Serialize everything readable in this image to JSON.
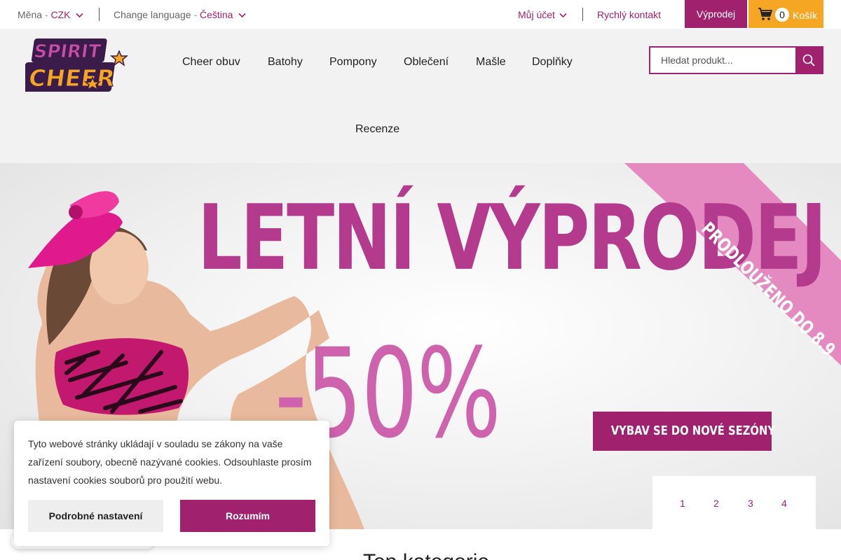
{
  "topbar": {
    "currency_label": "Měna",
    "currency_value": "CZK",
    "language_label": "Change language",
    "language_value": "Čeština",
    "separator": "-",
    "account": "Můj účet",
    "quick_contact": "Rychlý kontakt",
    "sale": "Výprodej",
    "cart_count": "0",
    "cart_label": "Košík"
  },
  "header": {
    "logo_line1": "SPIRIT",
    "logo_line2": "CHEER",
    "nav": [
      "Cheer obuv",
      "Batohy",
      "Pompony",
      "Oblečení",
      "Mašle",
      "Doplňky",
      "Recenze"
    ],
    "search_placeholder": "Hledat produkt..."
  },
  "hero": {
    "title": "LETNÍ VÝPRODEJ",
    "discount": "-50%",
    "ribbon": "PRODLOUŽENO DO 8.9.",
    "cta": "VYBAV SE DO NOVÉ SEZÓNY",
    "pages": [
      "1",
      "2",
      "3",
      "4"
    ]
  },
  "cookie": {
    "text": "Tyto webové stránky ukládají v souladu se zákony na vaše zařízení soubory, obecně nazývané cookies. Odsouhlaste prosím nastavení cookies souborů pro použití webu.",
    "settings_button": "Podrobné nastavení",
    "accept_button": "Rozumím"
  },
  "section": {
    "partial_title": "Top kategorie"
  },
  "colors": {
    "brand": "#a0226e",
    "cart": "#f5a623",
    "header_bg": "#f2f2f2"
  },
  "icons": [
    "chevron-down-icon",
    "cart-icon",
    "search-icon"
  ]
}
